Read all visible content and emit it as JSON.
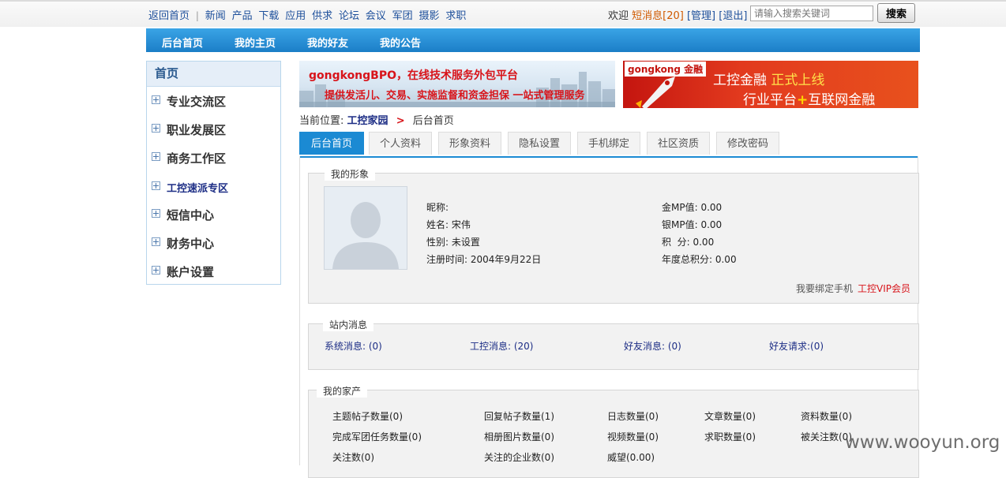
{
  "topbar": {
    "links": [
      "返回首页",
      "|",
      "新闻",
      "产品",
      "下载",
      "应用",
      "供求",
      "论坛",
      "会议",
      "军团",
      "摄影",
      "求职"
    ],
    "welcome": "欢迎",
    "sms_label": "短消息[20]",
    "manage": "[管理]",
    "logout": "[退出]",
    "search_placeholder": "请输入搜索关键词",
    "search_button": "搜索"
  },
  "nav": {
    "items": [
      "后台首页",
      "我的主页",
      "我的好友",
      "我的公告"
    ]
  },
  "sidebar": {
    "title": "首页",
    "items": [
      "专业交流区",
      "职业发展区",
      "商务工作区",
      "工控速派专区",
      "短信中心",
      "财务中心",
      "账户设置"
    ]
  },
  "banner1": {
    "line1": "gongkongBPO，在线技术服务外包平台",
    "line2": "提供发活儿、交易、实施监督和资金担保 一站式管理服务"
  },
  "banner2": {
    "logo": "gongkong 金融",
    "line1_a": "工控金融",
    "line1_b": "正式上线",
    "line2_a": "行业平台",
    "plus": "+",
    "line2_b": "互联网金融"
  },
  "breadcrumb": {
    "label": "当前位置:",
    "home": "工控家园",
    "arrow": ">",
    "current": "后台首页"
  },
  "tabs": [
    "后台首页",
    "个人资料",
    "形象资料",
    "隐私设置",
    "手机绑定",
    "社区资质",
    "修改密码"
  ],
  "profile": {
    "legend": "我的形象",
    "nickname": "昵称:",
    "name": "姓名: 宋伟",
    "gender": "性别: 未设置",
    "registered": "注册时间: 2004年9月22日",
    "gold": "金MP值: 0.00",
    "silver": "银MP值: 0.00",
    "points": "积  分: 0.00",
    "annual": "年度总积分: 0.00",
    "bind_phone": "我要绑定手机",
    "vip": "工控VIP会员"
  },
  "messages": {
    "legend": "站内消息",
    "system": "系统消息: (0)",
    "gongkong": "工控消息: (20)",
    "friend": "好友消息: (0)",
    "request": "好友请求:(0)"
  },
  "assets": {
    "legend": "我的家产",
    "items": [
      "主题帖子数量(0)",
      "回复帖子数量(1)",
      "日志数量(0)",
      "文章数量(0)",
      "资料数量(0)",
      "完成军团任务数量(0)",
      "相册图片数量(0)",
      "视频数量(0)",
      "求职数量(0)",
      "被关注数(0)",
      "关注数(0)",
      "关注的企业数(0)",
      "威望(0.00)"
    ]
  },
  "watermark": "www.wooyun.org"
}
